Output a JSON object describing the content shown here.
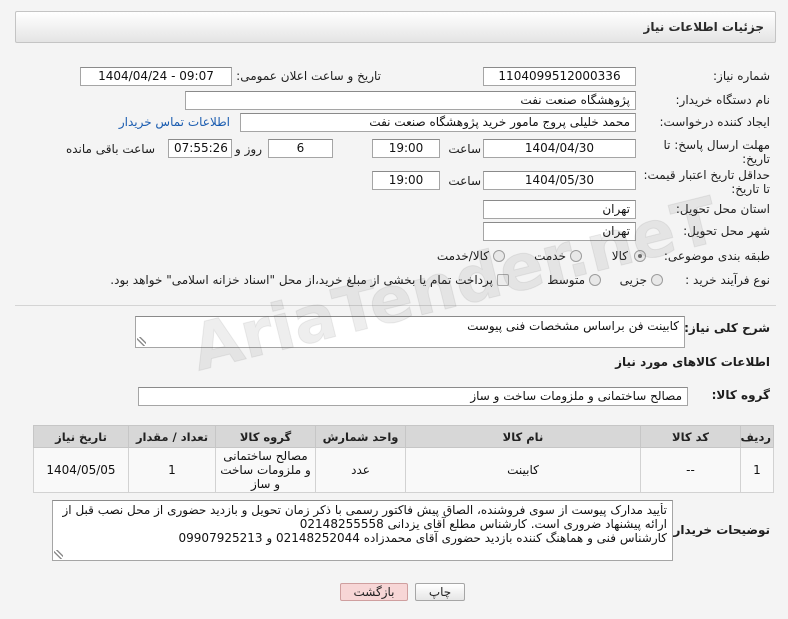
{
  "page": {
    "title": "جزئیات اطلاعات نیاز"
  },
  "watermark": "AriaTender.neT",
  "colors": {
    "link": "#1a5cb0",
    "back_button_bg": "#f7d6d6",
    "table_header_bg": "#d7d7d7"
  },
  "fields": {
    "need_number": {
      "label": "شماره نیاز:",
      "value": "1104099512000336"
    },
    "announce_datetime": {
      "label": "تاریخ و ساعت اعلان عمومی:",
      "value": "1404/04/24 - 09:07"
    },
    "buyer_org": {
      "label": "نام دستگاه خریدار:",
      "value": "پژوهشگاه صنعت نفت"
    },
    "requester": {
      "label": "ایجاد کننده درخواست:",
      "value": "محمد خلیلی پروج مامور خرید پژوهشگاه صنعت نفت",
      "contact_link": "اطلاعات تماس خریدار"
    },
    "response_deadline": {
      "label_line1": "مهلت ارسال پاسخ: تا",
      "label_line2": "تاریخ:",
      "date": "1404/04/30",
      "time_label": "ساعت",
      "time": "19:00",
      "days": "6",
      "days_label": "روز و",
      "remaining": "07:55:26",
      "remaining_label": "ساعت باقی مانده"
    },
    "price_validity": {
      "label_line1": "حداقل تاریخ اعتبار قیمت:",
      "label_line2": "تا تاریخ:",
      "date": "1404/05/30",
      "time_label": "ساعت",
      "time": "19:00"
    },
    "delivery_province": {
      "label": "استان محل تحویل:",
      "value": "تهران"
    },
    "delivery_city": {
      "label": "شهر محل تحویل:",
      "value": "تهران"
    },
    "subject_category": {
      "label": "طبقه بندی موضوعی:",
      "options": [
        {
          "label": "کالا",
          "checked": true
        },
        {
          "label": "خدمت",
          "checked": false
        },
        {
          "label": "کالا/خدمت",
          "checked": false
        }
      ]
    },
    "purchase_process": {
      "label": "نوع فرآیند خرید :",
      "options": [
        {
          "label": "جزیی",
          "checked": false
        },
        {
          "label": "متوسط",
          "checked": false
        }
      ],
      "treasury": {
        "label": "پرداخت تمام یا بخشی از مبلغ خرید،از محل \"اسناد خزانه اسلامی\" خواهد بود.",
        "checked": false
      }
    }
  },
  "description": {
    "label": "شرح کلی نیاز:",
    "value": "کابینت فن براساس مشخصات فنی پیوست"
  },
  "goods": {
    "heading": "اطلاعات کالاهای مورد نیاز",
    "group_label": "گروه کالا:",
    "group_value": "مصالح ساختمانی و ملزومات ساخت و ساز",
    "table": {
      "headers": [
        "ردیف",
        "کد کالا",
        "نام کالا",
        "واحد شمارش",
        "گروه کالا",
        "تعداد / مقدار",
        "تاریخ نیاز"
      ],
      "rows": [
        [
          "1",
          "--",
          "کابینت",
          "عدد",
          "مصالح ساختمانی و ملزومات ساخت و ساز",
          "1",
          "1404/05/05"
        ]
      ]
    }
  },
  "buyer_notes": {
    "label": "توضیحات خریدار:",
    "value": "تأیید مدارک پیوست از سوی فروشنده، الصاق پیش فاکتور رسمی با ذکر زمان تحویل و بازدید حضوری از محل نصب قبل از ارائه پیشنهاد ضروری است. کارشناس مطلع آقای یزدانی 02148255558\nکارشناس فنی و هماهنگ کننده بازدید حضوری آقای محمدزاده 02148252044 و 09907925213"
  },
  "buttons": {
    "print": "چاپ",
    "back": "بازگشت"
  }
}
